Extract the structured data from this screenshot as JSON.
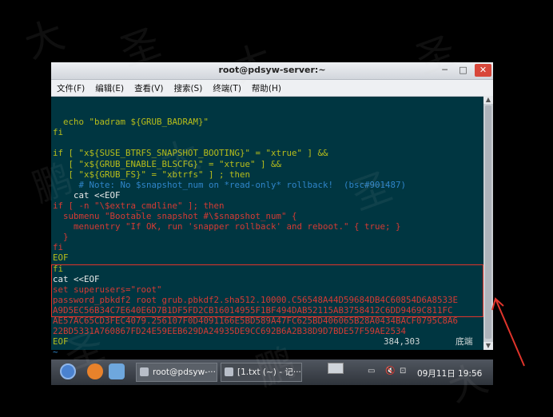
{
  "window": {
    "title": "root@pdsyw-server:~",
    "minimize_glyph": "─",
    "maximize_glyph": "□",
    "close_glyph": "✕"
  },
  "menubar": [
    "文件(F)",
    "编辑(E)",
    "查看(V)",
    "搜索(S)",
    "终端(T)",
    "帮助(H)"
  ],
  "terminal": {
    "lines": [
      {
        "class": "yel",
        "text": "  echo \"badram ${GRUB_BADRAM}\""
      },
      {
        "class": "yel",
        "text": "fi"
      },
      {
        "class": "yel",
        "text": ""
      },
      {
        "class": "yel",
        "text": "if [ \"x${SUSE_BTRFS_SNAPSHOT_BOOTING}\" = \"xtrue\" ] &&"
      },
      {
        "class": "yel",
        "text": "   [ \"x${GRUB_ENABLE_BLSCFG}\" = \"xtrue\" ] &&"
      },
      {
        "class": "yel",
        "text": "   [ \"x${GRUB_FS}\" = \"xbtrfs\" ] ; then"
      },
      {
        "class": "blue",
        "text": "     # Note: No $snapshot_num on *read-only* rollback!  (bsc#901487)"
      },
      {
        "class": "white",
        "text": "    cat <<EOF"
      },
      {
        "class": "red",
        "text": "if [ -n \"\\$extra_cmdline\" ]; then"
      },
      {
        "class": "red",
        "text": "  submenu \"Bootable snapshot #\\$snapshot_num\" {"
      },
      {
        "class": "red",
        "text": "    menuentry \"If OK, run 'snapper rollback' and reboot.\" { true; }"
      },
      {
        "class": "red",
        "text": "  }"
      },
      {
        "class": "red",
        "text": "fi"
      },
      {
        "class": "yel",
        "text": "EOF"
      },
      {
        "class": "yel",
        "text": "fi"
      },
      {
        "class": "white",
        "text": "cat <<EOF"
      },
      {
        "class": "red",
        "text": "set superusers=\"root\""
      },
      {
        "class": "red",
        "text": "password_pbkdf2 root grub.pbkdf2.sha512.10000.C56548A44D59684DB4C60854D6A8533E"
      },
      {
        "class": "red",
        "text": "A9D5EC56B34C7E640E6D7B1DF5FD2CB16014955F1BF494DAB52115AB3758412C6DD9469C811FC"
      },
      {
        "class": "red",
        "text": "AE57AC65CD3FEC4079.256107F0D4091166E5BD589A47FC625BD406065B28A0434BACF0795C8A6"
      },
      {
        "class": "red",
        "text": "22BD5331A760867FD24E59EEB629DA24935DE9CC692B6A2B38D9D7BDE57F59AE2534"
      },
      {
        "class": "yel",
        "text": "EOF"
      },
      {
        "class": "blue",
        "text": "~"
      }
    ],
    "cursor_position": "384,303",
    "scroll_position": "底端"
  },
  "taskbar": {
    "task1_label": "root@pdsyw-···",
    "task2_label": "[1.txt (~) - 记···",
    "tray_mute": "🔇",
    "tray_net": "⊡",
    "clock": "09月11日 19:56"
  },
  "watermark_text": [
    "大",
    "圣",
    "鹏"
  ]
}
